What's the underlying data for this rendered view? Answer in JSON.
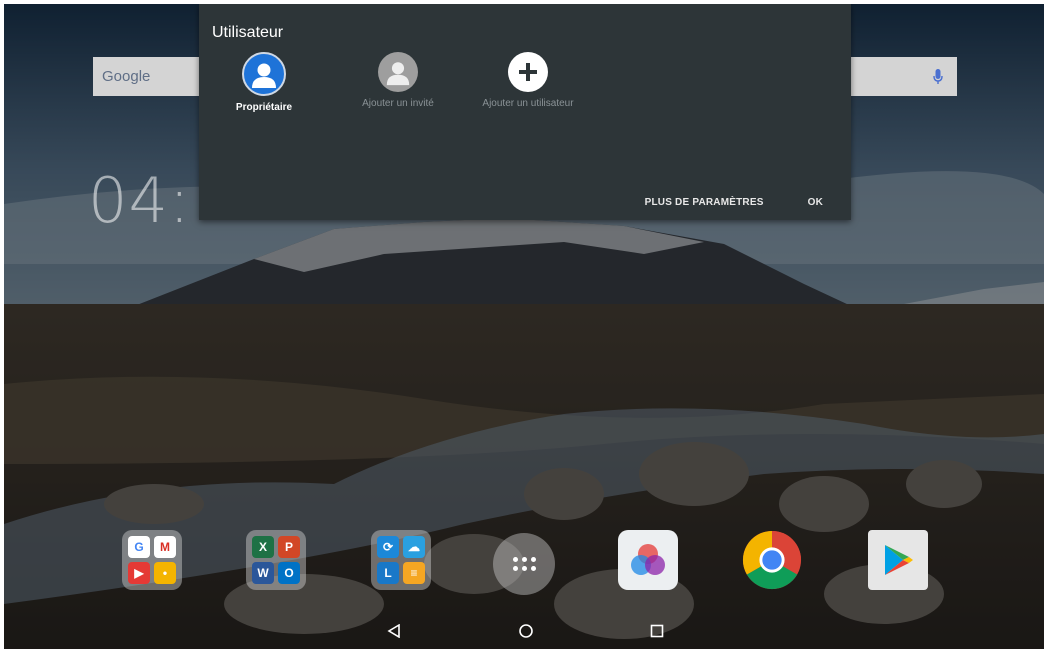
{
  "dialog": {
    "title": "Utilisateur",
    "users": [
      {
        "label": "Propriétaire",
        "icon": "person-avatar-icon",
        "selected": true
      },
      {
        "label": "Ajouter un invité",
        "icon": "guest-avatar-icon"
      },
      {
        "label": "Ajouter un utilisateur",
        "icon": "add-icon"
      }
    ],
    "actions": {
      "more_settings": "PLUS DE PARAMÈTRES",
      "ok": "OK"
    }
  },
  "search_bar": {
    "brand": "Google",
    "icon": "microphone-icon"
  },
  "clock": {
    "time": "04:"
  },
  "dock": {
    "items": [
      {
        "name": "google-apps-folder",
        "type": "folder"
      },
      {
        "name": "office-apps-folder",
        "type": "folder"
      },
      {
        "name": "lenovo-apps-folder",
        "type": "folder"
      },
      {
        "name": "all-apps-button",
        "type": "app-drawer"
      },
      {
        "name": "photos-app-icon",
        "type": "app"
      },
      {
        "name": "chrome-icon",
        "type": "app"
      },
      {
        "name": "play-store-icon",
        "type": "app"
      }
    ]
  },
  "nav": {
    "back": "back-icon",
    "home": "home-icon",
    "recents": "recents-icon"
  },
  "colors": {
    "dialog_bg": "#2d3538",
    "owner_accent": "#1e73d8",
    "secondary_text": "#8a9296"
  }
}
